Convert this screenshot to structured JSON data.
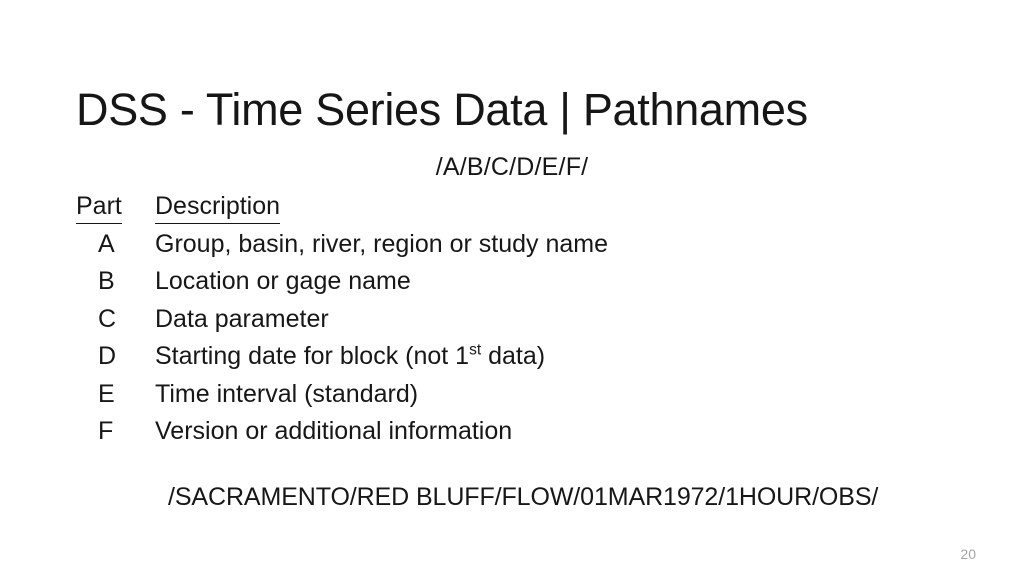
{
  "slide": {
    "title": "DSS - Time Series Data | Pathnames",
    "path_format": "/A/B/C/D/E/F/",
    "table": {
      "headers": {
        "part": "Part",
        "description": "Description"
      },
      "rows": [
        {
          "part": "A",
          "description": "Group, basin, river, region or study name"
        },
        {
          "part": "B",
          "description": "Location or gage name"
        },
        {
          "part": "C",
          "description": "Data parameter"
        },
        {
          "part": "D",
          "description_before": "Starting date for block (not 1",
          "description_sup": "st",
          "description_after": " data)"
        },
        {
          "part": "E",
          "description": "Time interval (standard)"
        },
        {
          "part": "F",
          "description": "Version or additional information"
        }
      ]
    },
    "path_example": "/SACRAMENTO/RED BLUFF/FLOW/01MAR1972/1HOUR/OBS/",
    "slide_number": "20"
  }
}
